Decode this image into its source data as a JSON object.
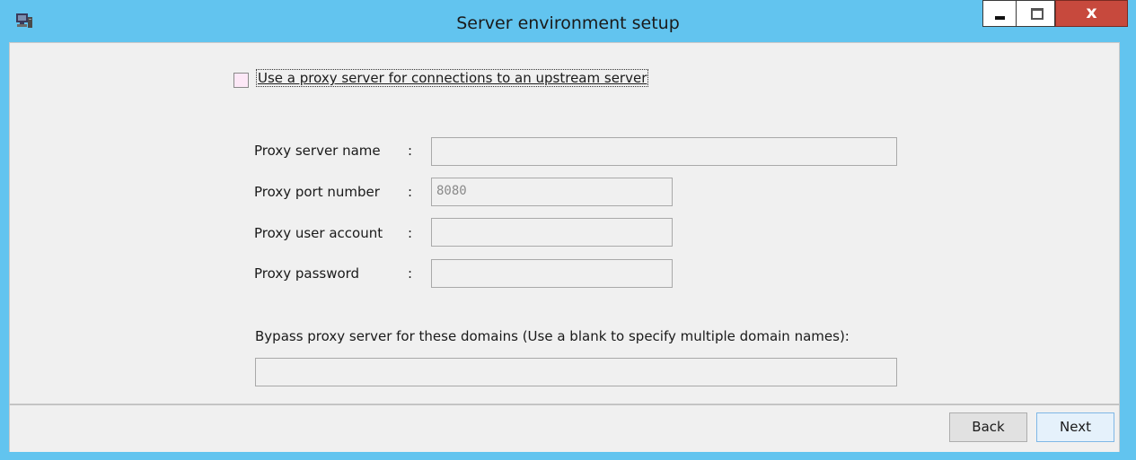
{
  "window": {
    "title": "Server environment setup",
    "close_glyph": "x",
    "app_icon": "computer-network-icon",
    "frame_color": "#62c4ef",
    "close_color": "#c7493d"
  },
  "proxy": {
    "use_proxy_label": "Use a proxy server for connections to an upstream server",
    "use_proxy_checked": false,
    "fields": [
      {
        "label": "Proxy server name",
        "colon": ":",
        "value": ""
      },
      {
        "label": "Proxy port number",
        "colon": ":",
        "value": "8080"
      },
      {
        "label": "Proxy user account",
        "colon": ":",
        "value": ""
      },
      {
        "label": "Proxy password",
        "colon": ":",
        "value": ""
      }
    ],
    "bypass_label": "Bypass proxy server for these domains (Use a blank to specify multiple domain names):",
    "bypass_value": ""
  },
  "footer": {
    "back_label": "Back",
    "next_label": "Next"
  }
}
